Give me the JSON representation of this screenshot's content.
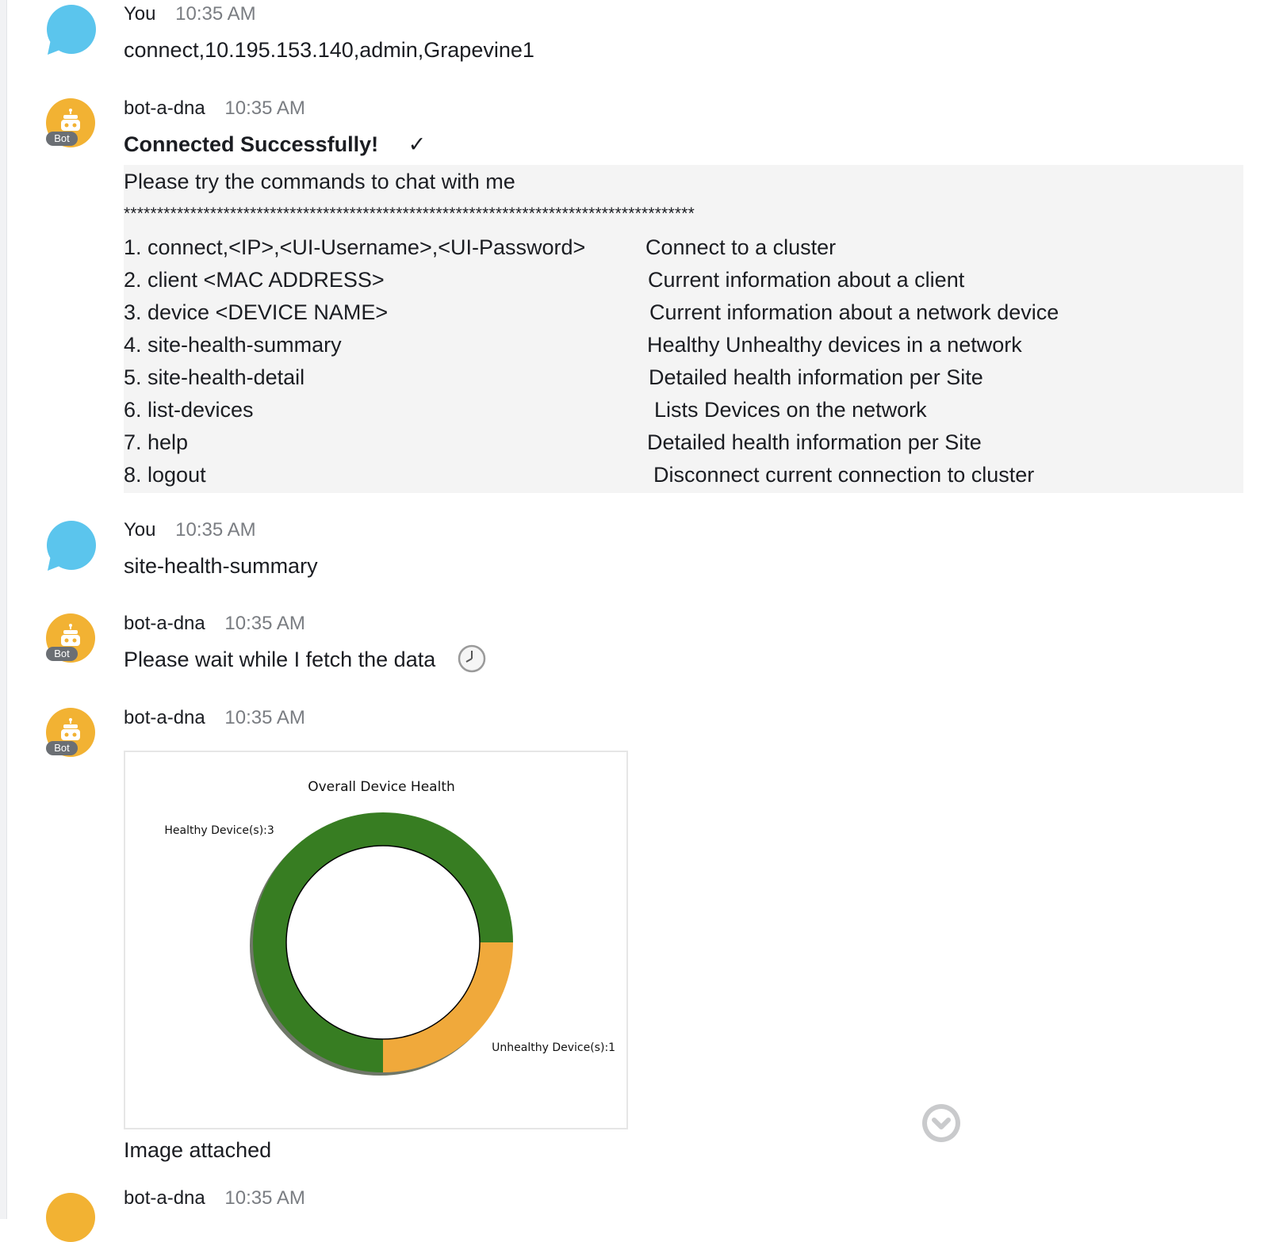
{
  "messages": {
    "m1": {
      "author": "You",
      "time": "10:35 AM",
      "text": "connect,10.195.153.140,admin,Grapevine1"
    },
    "m2": {
      "author": "bot-a-dna",
      "time": "10:35 AM",
      "badge": "Bot",
      "title": "Connected Successfully!",
      "check": "✓",
      "intro": "Please try the commands to chat with me",
      "stars": "**************************************************************************************",
      "commands": [
        {
          "cmd": "1. connect,<IP>,<UI-Username>,<UI-Password>",
          "desc": "Connect to a cluster"
        },
        {
          "cmd": "2. client <MAC ADDRESS>",
          "desc": "Current information about a client"
        },
        {
          "cmd": "3. device <DEVICE NAME>",
          "desc": "Current information about a network device"
        },
        {
          "cmd": "4. site-health-summary",
          "desc": "Healthy Unhealthy devices in a network"
        },
        {
          "cmd": "5. site-health-detail",
          "desc": "Detailed health information per Site"
        },
        {
          "cmd": "6. list-devices",
          "desc": "Lists Devices on the network"
        },
        {
          "cmd": "7. help",
          "desc": "Detailed health information per Site"
        },
        {
          "cmd": "8. logout",
          "desc": "Disconnect current connection to cluster"
        }
      ]
    },
    "m3": {
      "author": "You",
      "time": "10:35 AM",
      "text": "site-health-summary"
    },
    "m4": {
      "author": "bot-a-dna",
      "time": "10:35 AM",
      "badge": "Bot",
      "text": "Please wait while I fetch the data",
      "icon": "clock-icon"
    },
    "m5": {
      "author": "bot-a-dna",
      "time": "10:35 AM",
      "badge": "Bot",
      "caption": "Image attached"
    },
    "m6": {
      "author": "bot-a-dna",
      "time": "10:35 AM"
    }
  },
  "colors": {
    "user_avatar": "#5bc5ed",
    "bot_avatar": "#f2b233",
    "healthy": "#377d22",
    "unhealthy": "#f0a93b"
  },
  "chart_data": {
    "type": "pie",
    "title": "Overall Device Health",
    "slices": [
      {
        "label": "Healthy Device(s):3",
        "value": 3,
        "color": "#377d22"
      },
      {
        "label": "Unhealthy Device(s):1",
        "value": 1,
        "color": "#f0a93b"
      }
    ]
  }
}
